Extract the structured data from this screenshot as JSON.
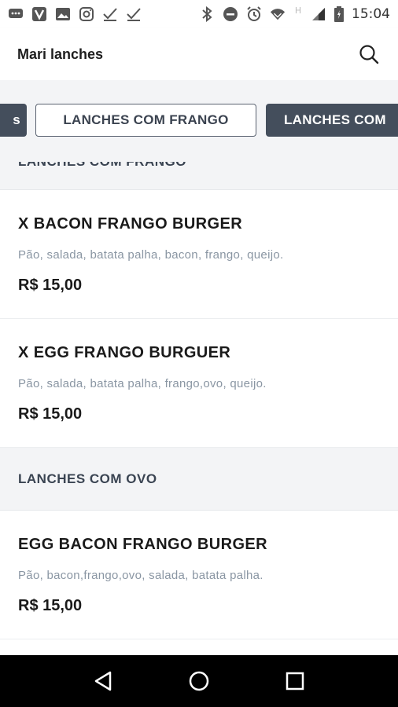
{
  "status_bar": {
    "time": "15:04",
    "left_icons": [
      "message-icon",
      "v-app-icon",
      "image-icon",
      "instagram-icon",
      "check-icon",
      "check-icon"
    ],
    "right_icons": [
      "bluetooth-icon",
      "do-not-disturb-icon",
      "alarm-icon",
      "wifi-icon",
      "h-network-icon",
      "signal-icon",
      "battery-icon"
    ],
    "network_label": "H"
  },
  "header": {
    "title": "Mari lanches"
  },
  "tabs": [
    {
      "label": "LANCHES COM OVO",
      "visible_fragment": "s",
      "style": "dark"
    },
    {
      "label": "LANCHES COM FRANGO",
      "style": "outline",
      "active": true
    },
    {
      "label": "LANCHES COM",
      "style": "dark"
    }
  ],
  "sections": [
    {
      "title": "LANCHES COM FRANGO",
      "items": [
        {
          "name": "X BACON FRANGO BURGER",
          "description": "Pão, salada, batata palha, bacon, frango, queijo.",
          "price": "R$ 15,00"
        },
        {
          "name": "X EGG FRANGO BURGUER",
          "description": "Pão, salada, batata palha, frango,ovo, queijo.",
          "price": "R$ 15,00"
        }
      ]
    },
    {
      "title": "LANCHES COM OVO",
      "items": [
        {
          "name": "EGG BACON FRANGO BURGER",
          "description": "Pão, bacon,frango,ovo, salada, batata palha.",
          "price": "R$ 15,00"
        }
      ]
    }
  ],
  "colors": {
    "tab_dark": "#444e5c",
    "section_bg": "#f3f4f6",
    "description": "#8a96a3"
  }
}
